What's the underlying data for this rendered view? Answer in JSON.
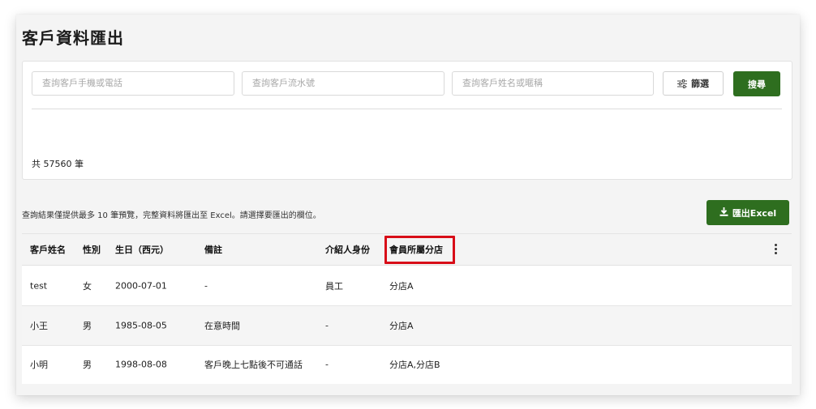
{
  "page": {
    "title": "客戶資料匯出"
  },
  "search": {
    "phone_placeholder": "查詢客戶手機或電話",
    "serial_placeholder": "查詢客戶流水號",
    "name_placeholder": "查詢客戶姓名或暱稱",
    "filter_label": "篩選",
    "search_label": "搜尋"
  },
  "summary": {
    "total": "共 57560 筆"
  },
  "notice": "查詢結果僅提供最多 10 筆預覽，完整資料將匯出至 Excel。請選擇要匯出的欄位。",
  "export": {
    "label": "匯出Excel"
  },
  "table": {
    "headers": [
      "客戶姓名",
      "性別",
      "生日（西元）",
      "備註",
      "介紹人身份",
      "會員所屬分店"
    ],
    "rows": [
      [
        "test",
        "女",
        "2000-07-01",
        "-",
        "員工",
        "分店A"
      ],
      [
        "小王",
        "男",
        "1985-08-05",
        "在意時間",
        "-",
        "分店A"
      ],
      [
        "小明",
        "男",
        "1998-08-08",
        "客戶晚上七點後不可通話",
        "-",
        "分店A,分店B"
      ]
    ],
    "highlighted_column": "會員所屬分店"
  },
  "colors": {
    "primary": "#2e6e1f",
    "highlight": "#d80d18",
    "page_bg": "#f4f4f4"
  },
  "icons": {
    "filter": "sliders-icon",
    "export": "download-icon",
    "more": "more-vertical-icon"
  }
}
